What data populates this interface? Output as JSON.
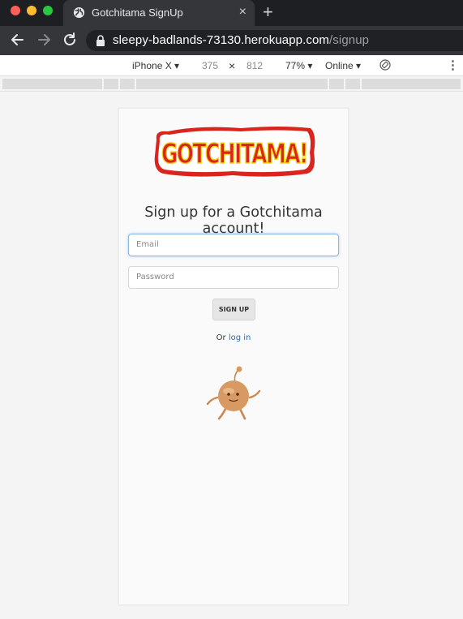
{
  "browser": {
    "tab_title": "Gotchitama SignUp",
    "tab_close": "×",
    "new_tab": "+",
    "url_host": "sleepy-badlands-73130.herokuapp.com",
    "url_path": "/signup"
  },
  "device_toolbar": {
    "device": "iPhone X ▾",
    "width": "375",
    "times": "×",
    "height": "812",
    "zoom": "77% ▾",
    "network": "Online ▾",
    "more": "⋮"
  },
  "page": {
    "logo_text": "GOTCHITAMA!",
    "headline": "Sign up for a Gotchitama account!",
    "email_placeholder": "Email",
    "password_placeholder": "Password",
    "signup_label": "SIGN UP",
    "or_text": "Or ",
    "login_link": "log in"
  },
  "colors": {
    "logo_red": "#d9251d",
    "logo_yellow": "#f6d21c",
    "link_blue": "#2b6cb0",
    "mascot": "#d89a62"
  }
}
